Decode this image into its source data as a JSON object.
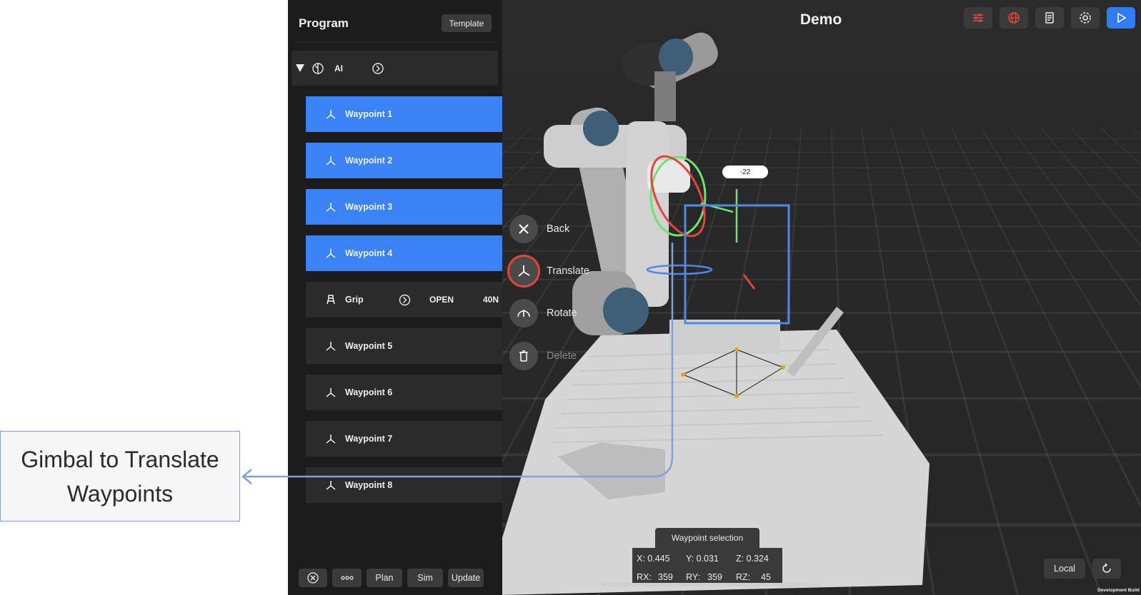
{
  "callout": {
    "text": "Gimbal to Translate Waypoints"
  },
  "app": {
    "title": "Demo"
  },
  "panel": {
    "title": "Program",
    "template_label": "Template",
    "ai_label": "AI",
    "items": [
      {
        "label": "Waypoint 1",
        "selected": true
      },
      {
        "label": "Waypoint 2",
        "selected": true
      },
      {
        "label": "Waypoint 3",
        "selected": true
      },
      {
        "label": "Waypoint 4",
        "selected": true
      },
      {
        "label": "Grip",
        "state": "OPEN",
        "force": "40N"
      },
      {
        "label": "Waypoint 5"
      },
      {
        "label": "Waypoint 6"
      },
      {
        "label": "Waypoint 7"
      },
      {
        "label": "Waypoint 8"
      }
    ],
    "bottom_buttons": {
      "plan": "Plan",
      "sim": "Sim",
      "update": "Update"
    }
  },
  "radial_menu": {
    "back": "Back",
    "translate": "Translate",
    "rotate": "Rotate",
    "delete": "Delete"
  },
  "gizmo": {
    "value": "-22"
  },
  "selection": {
    "title": "Waypoint selection",
    "x": "X: 0.445",
    "y": "Y: 0.031",
    "z": "Z: 0.324",
    "rx_label": "RX:",
    "rx": "359",
    "ry_label": "RY:",
    "ry": "359",
    "rz_label": "RZ:",
    "rz": "45"
  },
  "view": {
    "frame_label": "Local",
    "dev_build": "Development Build"
  },
  "icons": {
    "toolbar": [
      "sliders-icon",
      "globe-icon",
      "document-icon",
      "gear-icon",
      "play-icon"
    ]
  },
  "colors": {
    "accent": "#3b82f6",
    "danger": "#e0463c",
    "callout_line": "#7fa3d9"
  }
}
